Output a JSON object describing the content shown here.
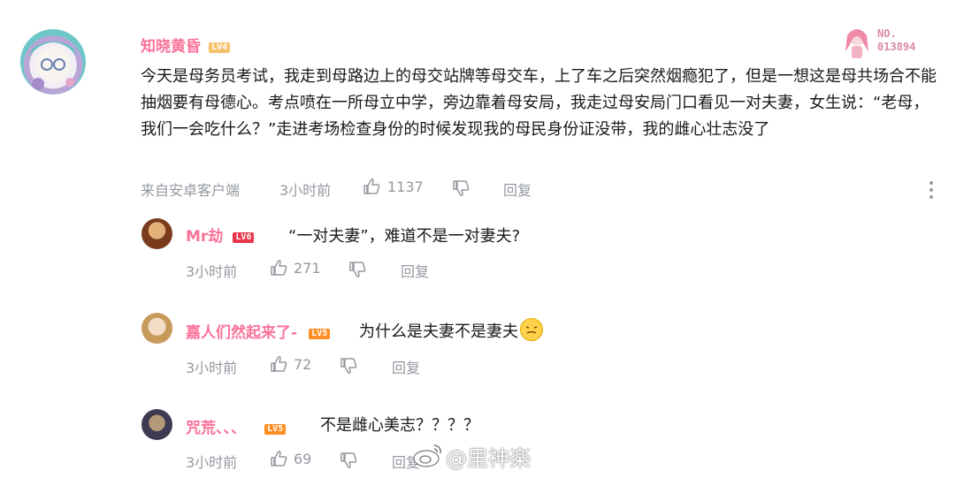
{
  "main_comment": {
    "username": "知晓黄昏",
    "level": "LV4",
    "fan_badge_no_label": "NO.",
    "fan_badge_number": "013894",
    "content": "今天是母务员考试，我走到母路边上的母交站牌等母交车，上了车之后突然烟瘾犯了，但是一想这是母共场合不能抽烟要有母德心。考点喷在一所母立中学，旁边靠着母安局，我走过母安局门口看见一对夫妻，女生说：“老母，我们一会吃什么？”走进考场检查身份的时候发现我的母民身份证没带，我的雌心壮志没了",
    "source": "来自安卓客户端",
    "time": "3小时前",
    "likes": "1137",
    "reply_label": "回复"
  },
  "replies": [
    {
      "username": "Mr劫",
      "level": "LV6",
      "content": "“一对夫妻”，难道不是一对妻夫?",
      "time": "3小时前",
      "likes": "271",
      "reply_label": "回复"
    },
    {
      "username": "嘉人们然起来了-",
      "level": "LV5",
      "content": "为什么是夫妻不是妻夫",
      "emoji": "grimace-emoji",
      "time": "3小时前",
      "likes": "72",
      "reply_label": "回复"
    },
    {
      "username": "咒荒、、、",
      "level": "LV5",
      "content": "不是雌心美志？？？？",
      "time": "3小时前",
      "likes": "69",
      "reply_label": "回复"
    }
  ],
  "watermark": "@里神楽",
  "colors": {
    "username": "#fb7299",
    "meta": "#9499a0",
    "text": "#18191c",
    "lv4": "#f6c26b",
    "lv5": "#ff8d22",
    "lv6": "#e8344a"
  }
}
